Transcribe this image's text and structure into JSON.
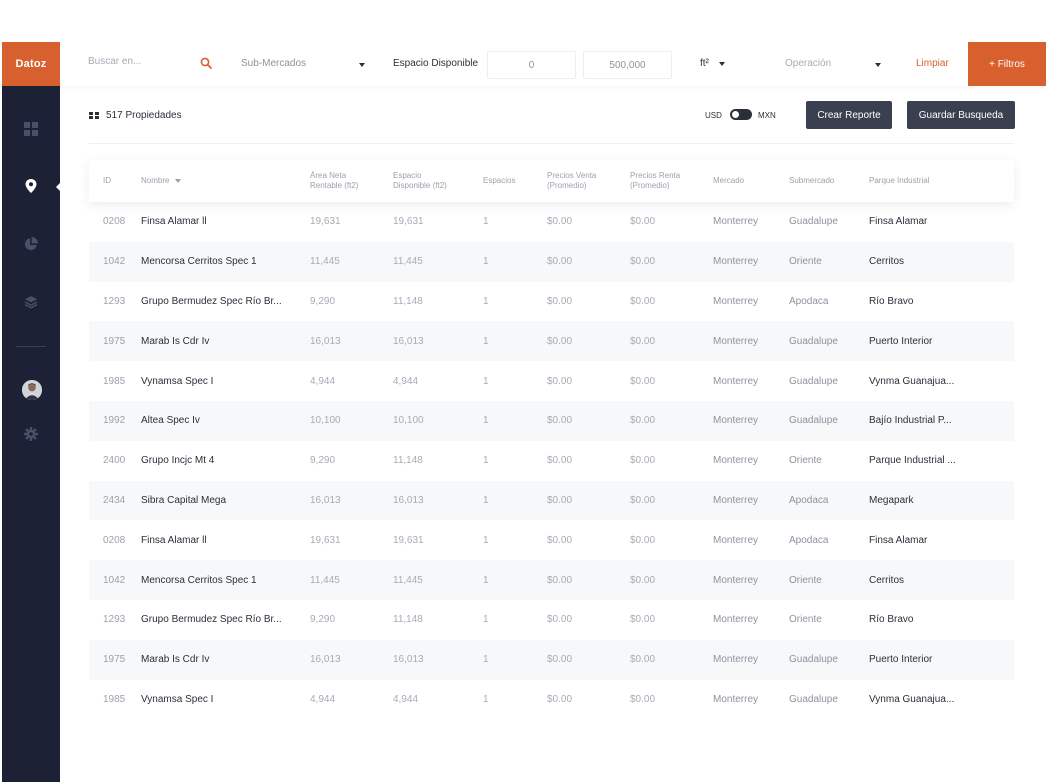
{
  "app": {
    "logo": "Datoz"
  },
  "topbar": {
    "search_placeholder": "Buscar en...",
    "submercados": "Sub-Mercados",
    "espacio_label": "Espacio Disponible",
    "min_value": "0",
    "max_value": "500,000",
    "unit": "ft²",
    "operacion": "Operación",
    "limpiar": "Limpiar",
    "filtros": "+ Filtros"
  },
  "header": {
    "count": "517 Propiedades",
    "currency_left": "USD",
    "currency_right": "MXN",
    "crear_reporte": "Crear Reporte",
    "guardar_busqueda": "Guardar Busqueda"
  },
  "columns": {
    "id": "ID",
    "nombre": "Nombre",
    "area_1": "Área Neta",
    "area_2": "Rentable (ft2)",
    "espacio_1": "Espacio",
    "espacio_2": "Disponible (ft2)",
    "espacios": "Espacios",
    "venta_1": "Precios Venta",
    "venta_2": "(Promedio)",
    "renta_1": "Precios Renta",
    "renta_2": "(Promedio)",
    "mercado": "Mercado",
    "submercado": "Submercado",
    "parque": "Parque Industrial"
  },
  "rows": [
    {
      "id": "0208",
      "nombre": "Finsa Alamar ll",
      "area": "19,631",
      "espacio": "19,631",
      "espacios": "1",
      "venta": "$0.00",
      "renta": "$0.00",
      "mercado": "Monterrey",
      "submercado": "Guadalupe",
      "parque": "Finsa Alamar"
    },
    {
      "id": "1042",
      "nombre": "Mencorsa Cerritos Spec 1",
      "area": "11,445",
      "espacio": "11,445",
      "espacios": "1",
      "venta": "$0.00",
      "renta": "$0.00",
      "mercado": "Monterrey",
      "submercado": "Oriente",
      "parque": "Cerritos"
    },
    {
      "id": "1293",
      "nombre": "Grupo Bermudez Spec Río Br...",
      "area": "9,290",
      "espacio": "11,148",
      "espacios": "1",
      "venta": "$0.00",
      "renta": "$0.00",
      "mercado": "Monterrey",
      "submercado": "Apodaca",
      "parque": "Río Bravo"
    },
    {
      "id": "1975",
      "nombre": "Marab Is Cdr Iv",
      "area": "16,013",
      "espacio": "16,013",
      "espacios": "1",
      "venta": "$0.00",
      "renta": "$0.00",
      "mercado": "Monterrey",
      "submercado": "Guadalupe",
      "parque": "Puerto Interior"
    },
    {
      "id": "1985",
      "nombre": "Vynamsa Spec I",
      "area": "4,944",
      "espacio": "4,944",
      "espacios": "1",
      "venta": "$0.00",
      "renta": "$0.00",
      "mercado": "Monterrey",
      "submercado": "Guadalupe",
      "parque": "Vynma Guanajua..."
    },
    {
      "id": "1992",
      "nombre": "Altea Spec Iv",
      "area": "10,100",
      "espacio": "10,100",
      "espacios": "1",
      "venta": "$0.00",
      "renta": "$0.00",
      "mercado": "Monterrey",
      "submercado": "Guadalupe",
      "parque": "Bajío Industrial P..."
    },
    {
      "id": "2400",
      "nombre": "Grupo Incjc Mt 4",
      "area": "9,290",
      "espacio": "11,148",
      "espacios": "1",
      "venta": "$0.00",
      "renta": "$0.00",
      "mercado": "Monterrey",
      "submercado": "Oriente",
      "parque": "Parque Industrial ..."
    },
    {
      "id": "2434",
      "nombre": "Sibra Capital Mega",
      "area": "16,013",
      "espacio": "16,013",
      "espacios": "1",
      "venta": "$0.00",
      "renta": "$0.00",
      "mercado": "Monterrey",
      "submercado": "Apodaca",
      "parque": "Megapark"
    },
    {
      "id": "0208",
      "nombre": "Finsa Alamar ll",
      "area": "19,631",
      "espacio": "19,631",
      "espacios": "1",
      "venta": "$0.00",
      "renta": "$0.00",
      "mercado": "Monterrey",
      "submercado": "Apodaca",
      "parque": "Finsa Alamar"
    },
    {
      "id": "1042",
      "nombre": "Mencorsa Cerritos Spec 1",
      "area": "11,445",
      "espacio": "11,445",
      "espacios": "1",
      "venta": "$0.00",
      "renta": "$0.00",
      "mercado": "Monterrey",
      "submercado": "Oriente",
      "parque": "Cerritos"
    },
    {
      "id": "1293",
      "nombre": "Grupo Bermudez Spec Río Br...",
      "area": "9,290",
      "espacio": "11,148",
      "espacios": "1",
      "venta": "$0.00",
      "renta": "$0.00",
      "mercado": "Monterrey",
      "submercado": "Oriente",
      "parque": "Río Bravo"
    },
    {
      "id": "1975",
      "nombre": "Marab Is Cdr Iv",
      "area": "16,013",
      "espacio": "16,013",
      "espacios": "1",
      "venta": "$0.00",
      "renta": "$0.00",
      "mercado": "Monterrey",
      "submercado": "Guadalupe",
      "parque": "Puerto Interior"
    },
    {
      "id": "1985",
      "nombre": "Vynamsa Spec I",
      "area": "4,944",
      "espacio": "4,944",
      "espacios": "1",
      "venta": "$0.00",
      "renta": "$0.00",
      "mercado": "Monterrey",
      "submercado": "Guadalupe",
      "parque": "Vynma Guanajua..."
    }
  ],
  "colors": {
    "accent": "#d85f2e",
    "sidebar": "#1c2135",
    "row_alt": "#f7f8fa"
  },
  "icons": [
    "search-icon",
    "dashboard-icon",
    "map-pin-icon",
    "pie-chart-icon",
    "layers-icon",
    "gear-icon",
    "grid-icon"
  ]
}
